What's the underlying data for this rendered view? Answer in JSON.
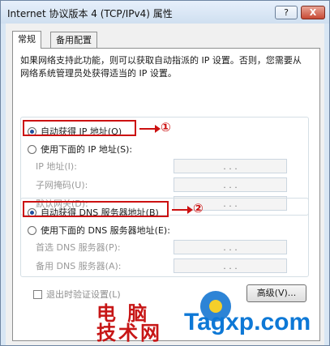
{
  "window": {
    "title": "Internet 协议版本 4 (TCP/IPv4) 属性",
    "help_label": "?",
    "close_label": "X"
  },
  "tabs": [
    {
      "label": "常规"
    },
    {
      "label": "备用配置"
    }
  ],
  "description": "如果网络支持此功能，则可以获取自动指派的 IP 设置。否则，您需要从网络系统管理员处获得适当的 IP 设置。",
  "ip_section": {
    "auto_label": "自动获得 IP 地址(O)",
    "manual_label": "使用下面的 IP 地址(S):",
    "fields": [
      {
        "label": "IP 地址(I):",
        "value": ". . ."
      },
      {
        "label": "子网掩码(U):",
        "value": ". . ."
      },
      {
        "label": "默认网关(D):",
        "value": ". . ."
      }
    ]
  },
  "dns_section": {
    "auto_label": "自动获得 DNS 服务器地址(B)",
    "manual_label": "使用下面的 DNS 服务器地址(E):",
    "fields": [
      {
        "label": "首选 DNS 服务器(P):",
        "value": ". . ."
      },
      {
        "label": "备用 DNS 服务器(A):",
        "value": ". . ."
      }
    ]
  },
  "footer": {
    "validate_label": "退出时验证设置(L)",
    "advanced_label": "高级(V)..."
  },
  "annotations": {
    "one": "①",
    "two": "②"
  },
  "watermark": {
    "text1": "电 脑",
    "text2": "技术网",
    "site": "Tagxp.com"
  },
  "colors": {
    "accent_red": "#cc1111",
    "brand_blue": "#0d78d6"
  }
}
